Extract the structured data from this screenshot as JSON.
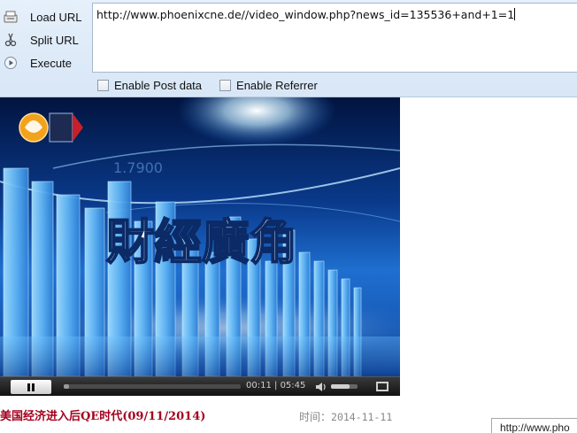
{
  "hackbar": {
    "actions": [
      {
        "label": "Load URL",
        "icon": "load-url-icon"
      },
      {
        "label": "Split URL",
        "icon": "scissors-icon"
      },
      {
        "label": "Execute",
        "icon": "play-arrow-icon"
      }
    ],
    "url_value": "http://www.phoenixcne.de//video_window.php?news_id=135536+and+1=1",
    "options": [
      {
        "label": "Enable Post data",
        "checked": false
      },
      {
        "label": "Enable Referrer",
        "checked": false
      }
    ]
  },
  "video": {
    "overlay_title": "財經廣角",
    "background_number": "1.7900",
    "logo_icon": "phoenix-tv-logo",
    "controls": {
      "play_state_icon": "pause-icon",
      "time_current": "00:11",
      "time_total": "05:45",
      "progress": 0.032,
      "volume_icon": "speaker-icon",
      "volume_level": 0.7,
      "fullscreen_icon": "fullscreen-icon"
    }
  },
  "news": {
    "title": "美国经济进入后QE时代(09/11/2014)",
    "time_label": "时间：",
    "time_value": "2014-11-11"
  },
  "share_url": "http://www.pho",
  "colors": {
    "toolbar_bg": "#dbe8f7",
    "title_red": "#a4001d",
    "video_blue": "#1e6fd0"
  }
}
